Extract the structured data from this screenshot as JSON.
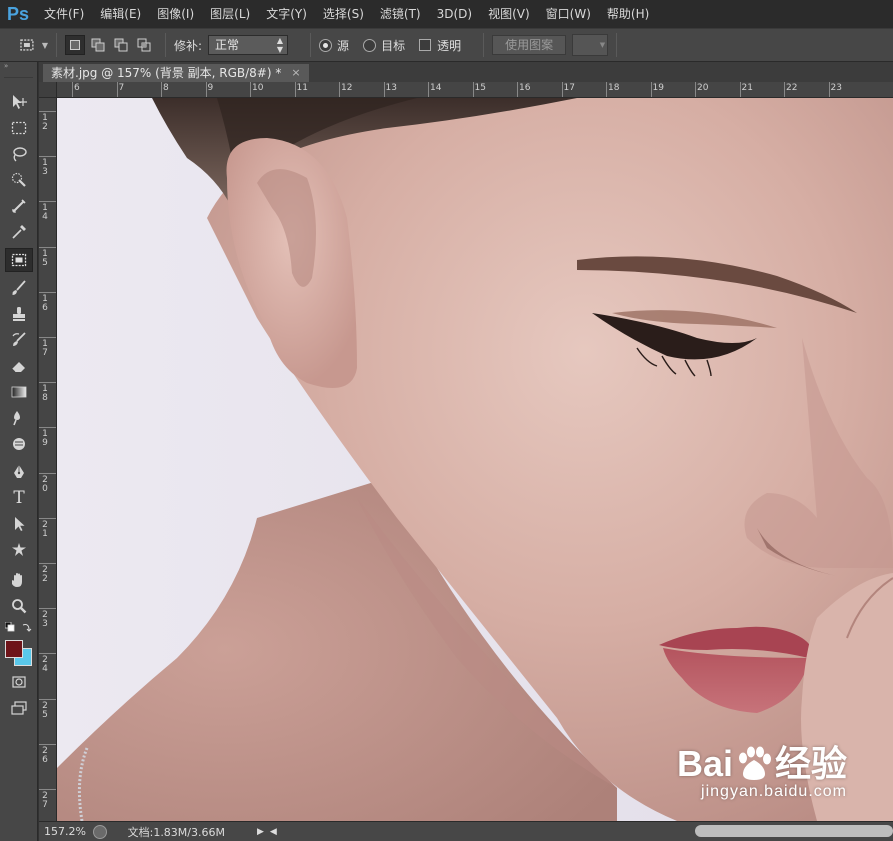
{
  "app": {
    "logo": "Ps"
  },
  "menu": [
    "文件(F)",
    "编辑(E)",
    "图像(I)",
    "图层(L)",
    "文字(Y)",
    "选择(S)",
    "滤镜(T)",
    "3D(D)",
    "视图(V)",
    "窗口(W)",
    "帮助(H)"
  ],
  "options": {
    "patch_label": "修补:",
    "patch_value": "正常",
    "source_label": "源",
    "destination_label": "目标",
    "transparent_label": "透明",
    "use_pattern_label": "使用图案",
    "source_selected": true,
    "transparent_checked": false
  },
  "document": {
    "tab_title": "素材.jpg @ 157% (背景 副本, RGB/8#) *",
    "close_glyph": "×"
  },
  "rulers": {
    "horizontal": [
      "6",
      "7",
      "8",
      "9",
      "10",
      "11",
      "12",
      "13",
      "14",
      "15",
      "16",
      "17",
      "18",
      "19",
      "20",
      "21",
      "22",
      "23"
    ],
    "vertical": [
      "1 2",
      "1 3",
      "1 4",
      "1 5",
      "1 6",
      "1 7",
      "1 8",
      "1 9",
      "2 0",
      "2 1",
      "2 2",
      "2 3",
      "2 4",
      "2 5",
      "2 6",
      "2 7"
    ]
  },
  "tools": [
    "move-tool-icon",
    "marquee-tool-icon",
    "lasso-tool-icon",
    "quick-selection-tool-icon",
    "crop-tool-icon",
    "eyedropper-tool-icon",
    "patch-tool-icon",
    "brush-tool-icon",
    "clone-stamp-tool-icon",
    "history-brush-tool-icon",
    "eraser-tool-icon",
    "gradient-tool-icon",
    "blur-tool-icon",
    "dodge-tool-icon",
    "pen-tool-icon",
    "type-tool-icon",
    "path-selection-tool-icon",
    "shape-tool-icon",
    "hand-tool-icon",
    "zoom-tool-icon"
  ],
  "type_tool_glyph": "T",
  "colors": {
    "foreground": "#6e1419",
    "background": "#5ac8ea",
    "accent": "#4aa3df"
  },
  "status": {
    "zoom": "157.2%",
    "doc_size": "文档:1.83M/3.66M"
  },
  "watermark": {
    "brand": "Bai",
    "brand_suffix": "经验",
    "url": "jingyan.baidu.com"
  }
}
